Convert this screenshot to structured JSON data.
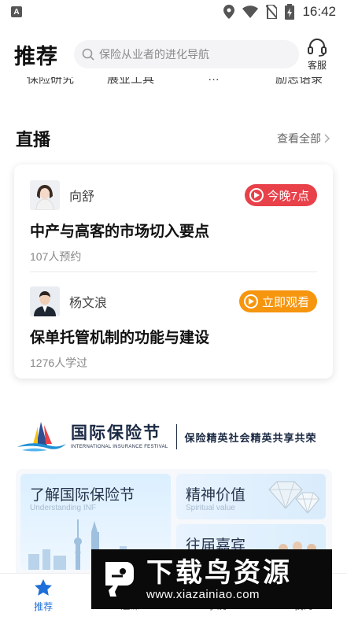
{
  "status_bar": {
    "time": "16:42",
    "app_icon_letter": "A"
  },
  "header": {
    "title": "推荐",
    "search_placeholder": "保险从业者的进化导航",
    "service_label": "客服"
  },
  "category_strip": [
    "保险研究",
    "展业工具",
    "…",
    "励志语录"
  ],
  "live": {
    "section_title": "直播",
    "see_all": "查看全部",
    "items": [
      {
        "host": "向舒",
        "badge": "今晚7点",
        "badge_color": "#e8414a",
        "title": "中产与高客的市场切入要点",
        "meta": "107人预约"
      },
      {
        "host": "杨文浪",
        "badge": "立即观看",
        "badge_color": "#f6950e",
        "title": "保单托管机制的功能与建设",
        "meta": "1276人学过"
      }
    ]
  },
  "festival": {
    "name": "国际保险节",
    "name_en": "INTERNATIONAL INSURANCE FESTIVAL",
    "slogan": "保险精英社会精英共享共荣",
    "cards": {
      "main": {
        "title": "了解国际保险节",
        "subtitle": "Understanding INF"
      },
      "spirit": {
        "title": "精神价值",
        "subtitle": "Spiritual value"
      },
      "past": {
        "title": "往届嘉宾"
      }
    }
  },
  "bottom_nav": [
    {
      "label": "推荐",
      "icon": "star-icon",
      "active": true
    },
    {
      "label": "题课",
      "icon": "book-icon",
      "active": false
    },
    {
      "label": "学院",
      "icon": "school-icon",
      "active": false
    },
    {
      "label": "我的",
      "icon": "user-icon",
      "active": false
    }
  ],
  "watermark": {
    "brand": "下载鸟资源",
    "url": "www.xiazainiao.com"
  },
  "colors": {
    "accent": "#1e6fd9",
    "live_red": "#e8414a",
    "live_orange": "#f6950e"
  }
}
